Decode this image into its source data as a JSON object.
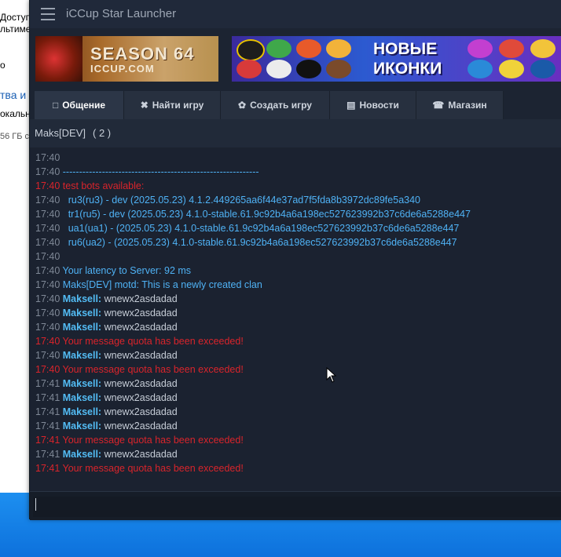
{
  "desktop": {
    "left_texts": [
      "Доступ",
      "льтимед",
      "о",
      "тва и",
      "окальн",
      "56 ГБ с"
    ]
  },
  "app": {
    "title": "iCCup Star Launcher"
  },
  "banners": {
    "season_title": "SEASON 64",
    "season_site": "ICCUP.COM",
    "icons_line1": "НОВЫЕ",
    "icons_line2": "ИКОНКИ"
  },
  "tabs": [
    {
      "label": "Общение",
      "icon": "chat-icon"
    },
    {
      "label": "Найти игру",
      "icon": "crossed-swords-icon"
    },
    {
      "label": "Создать игру",
      "icon": "create-game-icon"
    },
    {
      "label": "Новости",
      "icon": "news-icon"
    },
    {
      "label": "Магазин",
      "icon": "cart-icon"
    }
  ],
  "channel": {
    "name": "Maks[DEV]",
    "count": "( 2 )"
  },
  "chat": {
    "lines": [
      {
        "time": "17:40",
        "text": "",
        "kind": "sys"
      },
      {
        "time": "17:40",
        "text": "------------------------------------------------------------",
        "kind": "sys"
      },
      {
        "time": "17:40",
        "text": "test bots available:",
        "kind": "err"
      },
      {
        "time": "17:40",
        "text": "  ru3(ru3) - dev (2025.05.23) 4.1.2.449265aa6f44e37ad7f5fda8b3972dc89fe5a340",
        "kind": "sys"
      },
      {
        "time": "17:40",
        "text": "  tr1(ru5) - dev (2025.05.23) 4.1.0-stable.61.9c92b4a6a198ec527623992b37c6de6a5288e447",
        "kind": "sys"
      },
      {
        "time": "17:40",
        "text": "  ua1(ua1) - (2025.05.23) 4.1.0-stable.61.9c92b4a6a198ec527623992b37c6de6a5288e447",
        "kind": "sys"
      },
      {
        "time": "17:40",
        "text": "  ru6(ua2) - (2025.05.23) 4.1.0-stable.61.9c92b4a6a198ec527623992b37c6de6a5288e447",
        "kind": "sys"
      },
      {
        "time": "17:40",
        "text": "",
        "kind": "sys"
      },
      {
        "time": "17:40",
        "text": "Your latency to Server: 92 ms",
        "kind": "sys"
      },
      {
        "time": "17:40",
        "text": "Maks[DEV] motd: This is a newly created clan",
        "kind": "sys"
      },
      {
        "time": "17:40",
        "nick": "Maksell:",
        "text": "wnewx2asdadad",
        "kind": "user"
      },
      {
        "time": "17:40",
        "nick": "Maksell:",
        "text": "wnewx2asdadad",
        "kind": "user"
      },
      {
        "time": "17:40",
        "nick": "Maksell:",
        "text": "wnewx2asdadad",
        "kind": "user"
      },
      {
        "time": "17:40",
        "text": "Your message quota has been exceeded!",
        "kind": "err"
      },
      {
        "time": "17:40",
        "nick": "Maksell:",
        "text": "wnewx2asdadad",
        "kind": "user"
      },
      {
        "time": "17:40",
        "text": "Your message quota has been exceeded!",
        "kind": "err"
      },
      {
        "time": "17:41",
        "nick": "Maksell:",
        "text": "wnewx2asdadad",
        "kind": "user"
      },
      {
        "time": "17:41",
        "nick": "Maksell:",
        "text": "wnewx2asdadad",
        "kind": "user"
      },
      {
        "time": "17:41",
        "nick": "Maksell:",
        "text": "wnewx2asdadad",
        "kind": "user"
      },
      {
        "time": "17:41",
        "nick": "Maksell:",
        "text": "wnewx2asdadad",
        "kind": "user"
      },
      {
        "time": "17:41",
        "text": "Your message quota has been exceeded!",
        "kind": "err"
      },
      {
        "time": "17:41",
        "nick": "Maksell:",
        "text": "wnewx2asdadad",
        "kind": "user"
      },
      {
        "time": "17:41",
        "text": "Your message quota has been exceeded!",
        "kind": "err"
      }
    ]
  },
  "input": {
    "value": ""
  },
  "colors": {
    "error_red": "#d9242b",
    "system_blue": "#4fb2f5",
    "nick_blue": "#53bcf4"
  }
}
